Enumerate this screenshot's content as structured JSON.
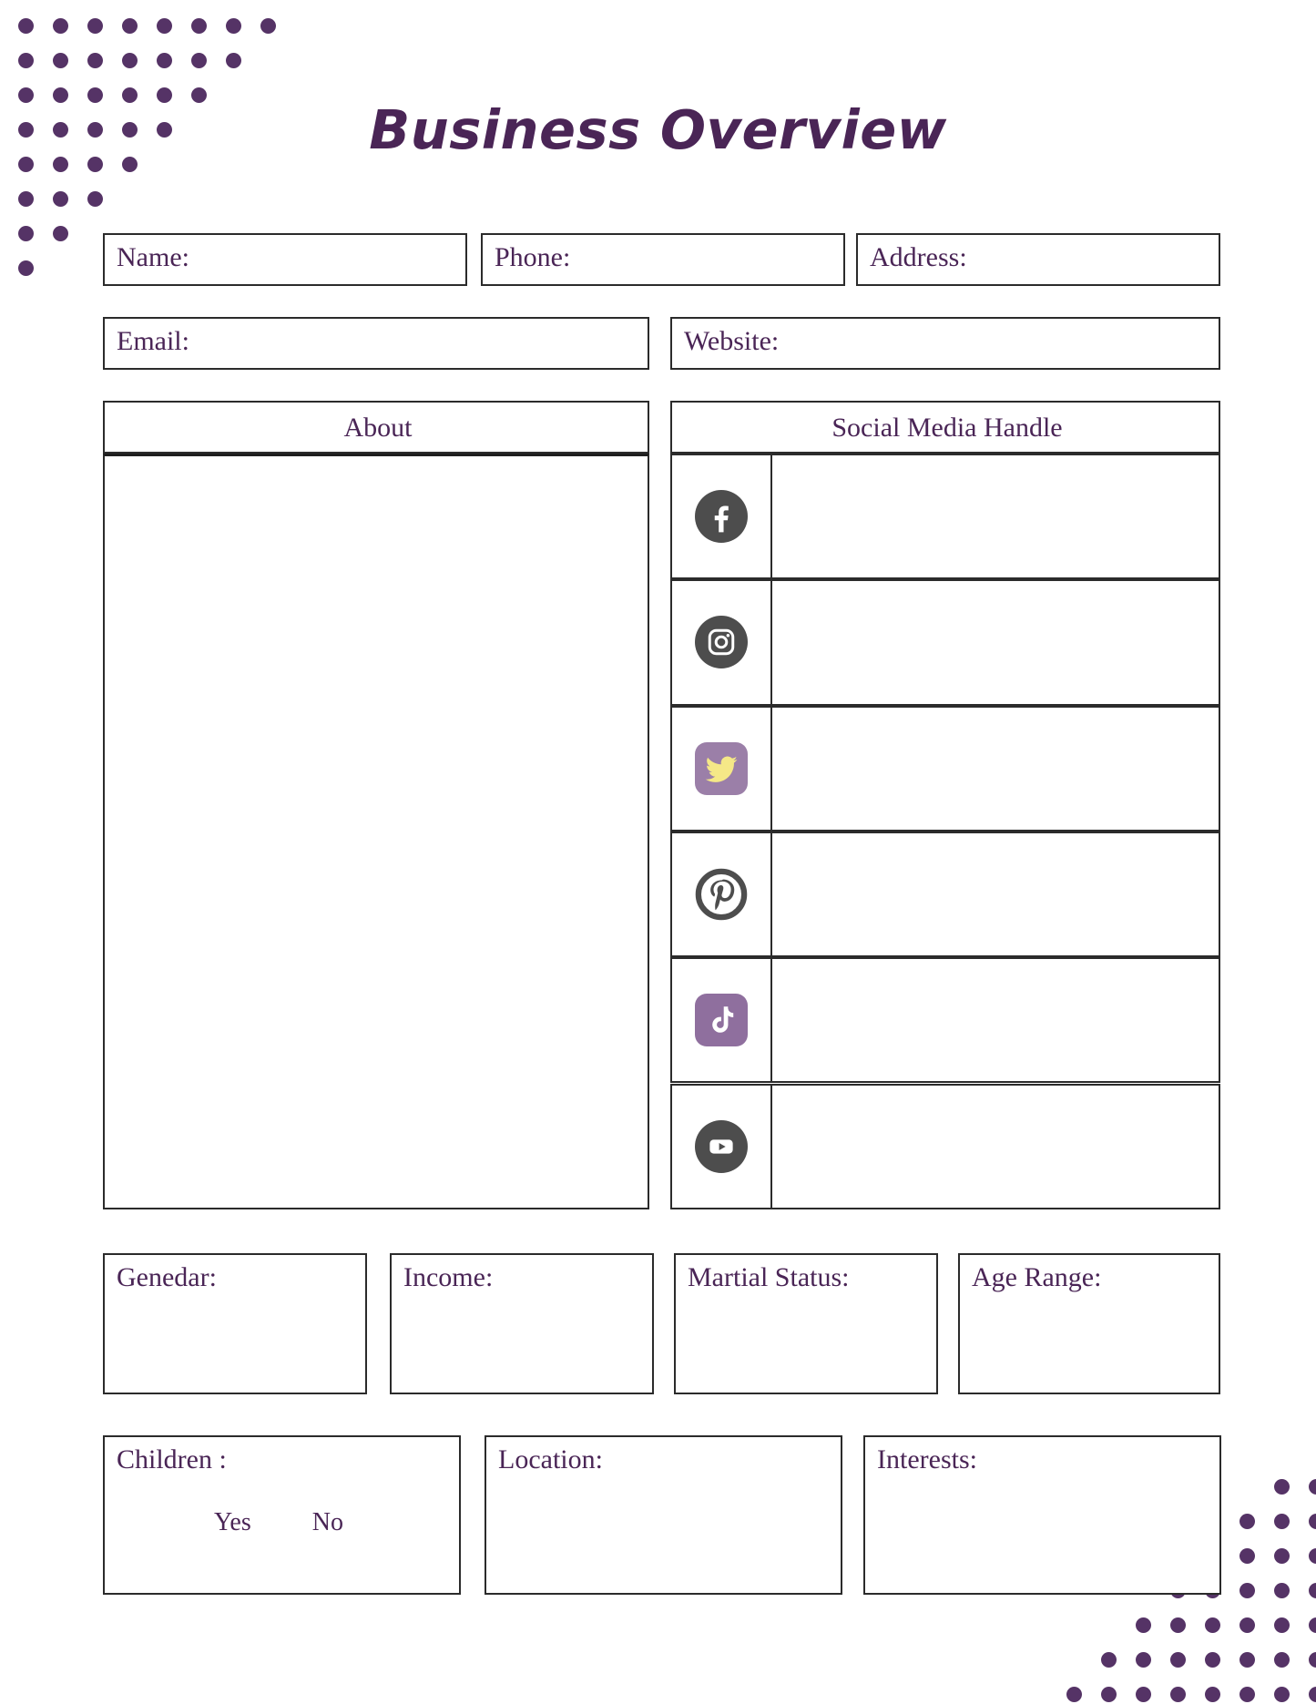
{
  "title": "Business Overview",
  "theme": {
    "purple": "#4a2556",
    "dot_purple": "#553366",
    "border": "#2b2b2b",
    "icon_gray": "#4d4d4d",
    "twitter_bg": "#9b7fa8",
    "twitter_bird": "#f5e887",
    "tiktok_bg": "#8f6f9e"
  },
  "contact": {
    "name_label": "Name:",
    "phone_label": "Phone:",
    "address_label": "Address:",
    "email_label": "Email:",
    "website_label": "Website:",
    "name_value": "",
    "phone_value": "",
    "address_value": "",
    "email_value": "",
    "website_value": ""
  },
  "about": {
    "header": "About",
    "value": ""
  },
  "social": {
    "header": "Social Media Handle",
    "rows": [
      {
        "icon": "facebook-icon",
        "platform": "Facebook",
        "handle": ""
      },
      {
        "icon": "instagram-icon",
        "platform": "Instagram",
        "handle": ""
      },
      {
        "icon": "twitter-icon",
        "platform": "Twitter",
        "handle": ""
      },
      {
        "icon": "pinterest-icon",
        "platform": "Pinterest",
        "handle": ""
      },
      {
        "icon": "tiktok-icon",
        "platform": "TikTok",
        "handle": ""
      },
      {
        "icon": "youtube-icon",
        "platform": "YouTube",
        "handle": ""
      }
    ]
  },
  "demographics": {
    "gender_label": "Genedar:",
    "income_label": "Income:",
    "marital_label": "Martial Status:",
    "age_range_label": "Age Range:",
    "gender_value": "",
    "income_value": "",
    "marital_value": "",
    "age_range_value": ""
  },
  "details": {
    "children_label": "Children :",
    "children_yes": "Yes",
    "children_no": "No",
    "location_label": "Location:",
    "interests_label": "Interests:",
    "location_value": "",
    "interests_value": ""
  },
  "decoration": {
    "top_left_rows": [
      8,
      7,
      6,
      5,
      4,
      3,
      2,
      1
    ],
    "bottom_right_rows": [
      1,
      2,
      3,
      4,
      5,
      6,
      7
    ],
    "dot_spacing": 38,
    "dot_size": 17
  }
}
